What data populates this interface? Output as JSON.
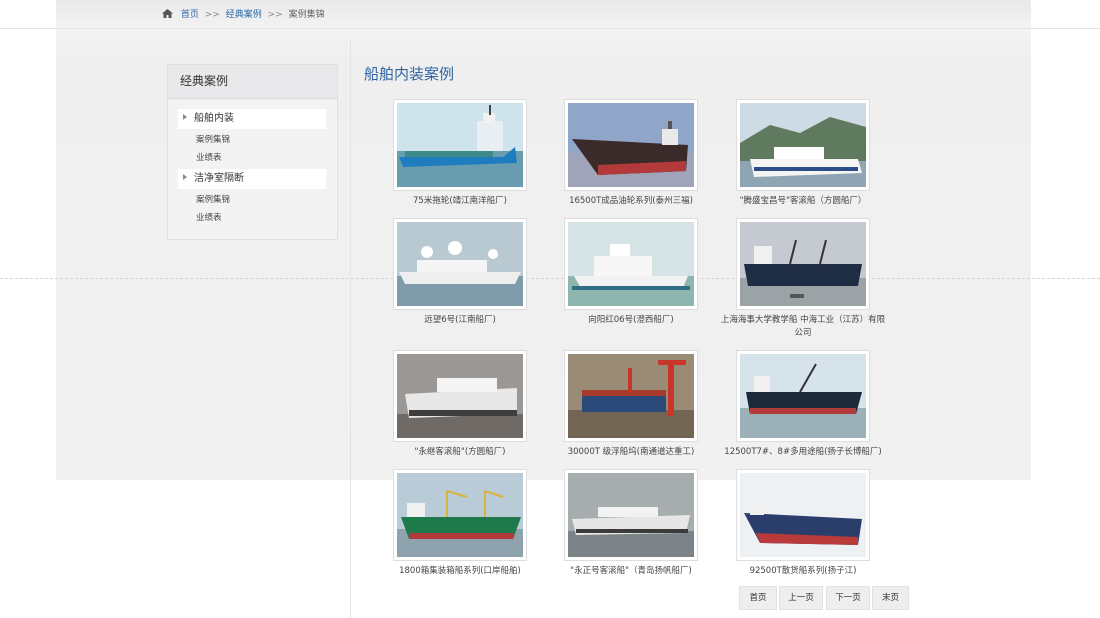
{
  "breadcrumb": {
    "home": "首页",
    "sep1": ">>",
    "category": "经典案例",
    "sep2": ">>",
    "current": "案例集锦"
  },
  "sidebar": {
    "title": "经典案例",
    "groups": [
      {
        "label": "船舶内装",
        "items": [
          "案例集锦",
          "业绩表"
        ]
      },
      {
        "label": "洁净室隔断",
        "items": [
          "案例集锦",
          "业绩表"
        ]
      }
    ]
  },
  "main": {
    "title": "船舶内装案例",
    "cases": [
      {
        "caption": "75米拖轮(靖江南洋船厂)",
        "icon": "ship-photo-tug"
      },
      {
        "caption": "16500T成品油轮系列(泰州三福)",
        "icon": "ship-photo-tanker"
      },
      {
        "caption": "\"腾盛宝昌号\"客滚船（方圆船厂）",
        "icon": "ship-photo-ferry"
      },
      {
        "caption": "远望6号(江南船厂)",
        "icon": "ship-photo-survey"
      },
      {
        "caption": "向阳红06号(澄西船厂)",
        "icon": "ship-photo-research"
      },
      {
        "caption": "上海海事大学教学船 中海工业（江苏）有限公司",
        "icon": "ship-photo-training"
      },
      {
        "caption": "\"永继客滚船\"(方圆船厂)",
        "icon": "ship-photo-roro"
      },
      {
        "caption": "30000T 级浮船坞(南通道达重工)",
        "icon": "ship-photo-dock"
      },
      {
        "caption": "12500T7#、8#多用途船(扬子长博船厂)",
        "icon": "ship-photo-multipurpose"
      },
      {
        "caption": "1800箱集装箱船系列(口岸船舶)",
        "icon": "ship-photo-container"
      },
      {
        "caption": "\"永正号客滚船\"（青岛扬帆船厂)",
        "icon": "ship-photo-ferry-grey"
      },
      {
        "caption": "92500T散货船系列(扬子江)",
        "icon": "ship-photo-bulk"
      }
    ]
  },
  "pager": {
    "first": "首页",
    "prev": "上一页",
    "next": "下一页",
    "last": "末页"
  },
  "colors": {
    "link": "#2a6aa8",
    "title": "#2f64a0"
  }
}
